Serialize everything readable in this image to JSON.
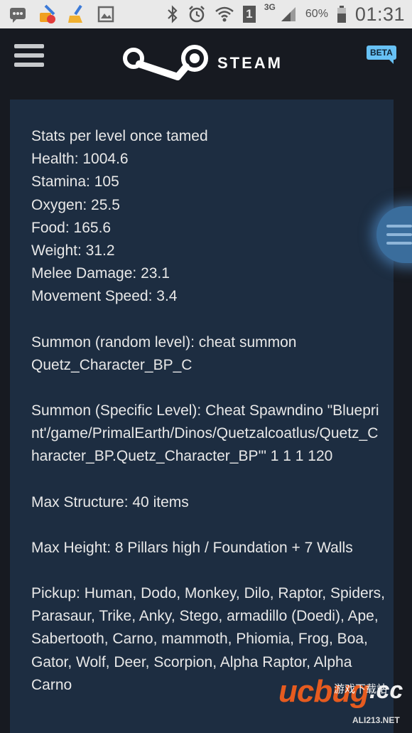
{
  "status_bar": {
    "network": "3G",
    "sim": "1",
    "battery": "60%",
    "time": "01:31"
  },
  "header": {
    "logo_text": "STEAM",
    "badge": "BETA"
  },
  "post": {
    "lines_stats": [
      "Stats per level once tamed",
      "Health: 1004.6",
      "Stamina: 105",
      "Oxygen: 25.5",
      "Food: 165.6",
      "Weight: 31.2",
      "Melee Damage: 23.1",
      "Movement Speed: 3.4"
    ],
    "summon_random": "Summon (random level): cheat summon Quetz_Character_BP_C",
    "summon_specific": "Summon (Specific Level): Cheat Spawndino \"Blueprint'/game/PrimalEarth/Dinos/Quetzalcoatlus/Quetz_Character_BP.Quetz_Character_BP'\" 1 1 1 120",
    "max_structure": "Max Structure: 40 items",
    "max_height": "Max Height: 8 Pillars high / Foundation + 7 Walls",
    "pickup": "Pickup: Human, Dodo, Monkey, Dilo, Raptor, Spiders, Parasaur, Trike, Anky, Stego, armadillo (Doedi), Ape, Sabertooth, Carno, mammoth, Phiomia, Frog, Boa, Gator, Wolf, Deer, Scorpion, Alpha Raptor, Alpha Carno"
  },
  "watermark": {
    "brand": "ucbug",
    "tld": ".cc",
    "cn": "游戏下载站",
    "url": "ALI213.NET"
  },
  "colors": {
    "header_bg": "#171a21",
    "panel_bg": "#1d2d41",
    "text": "#e8e8e8",
    "beta_bg": "#67c1f5"
  }
}
